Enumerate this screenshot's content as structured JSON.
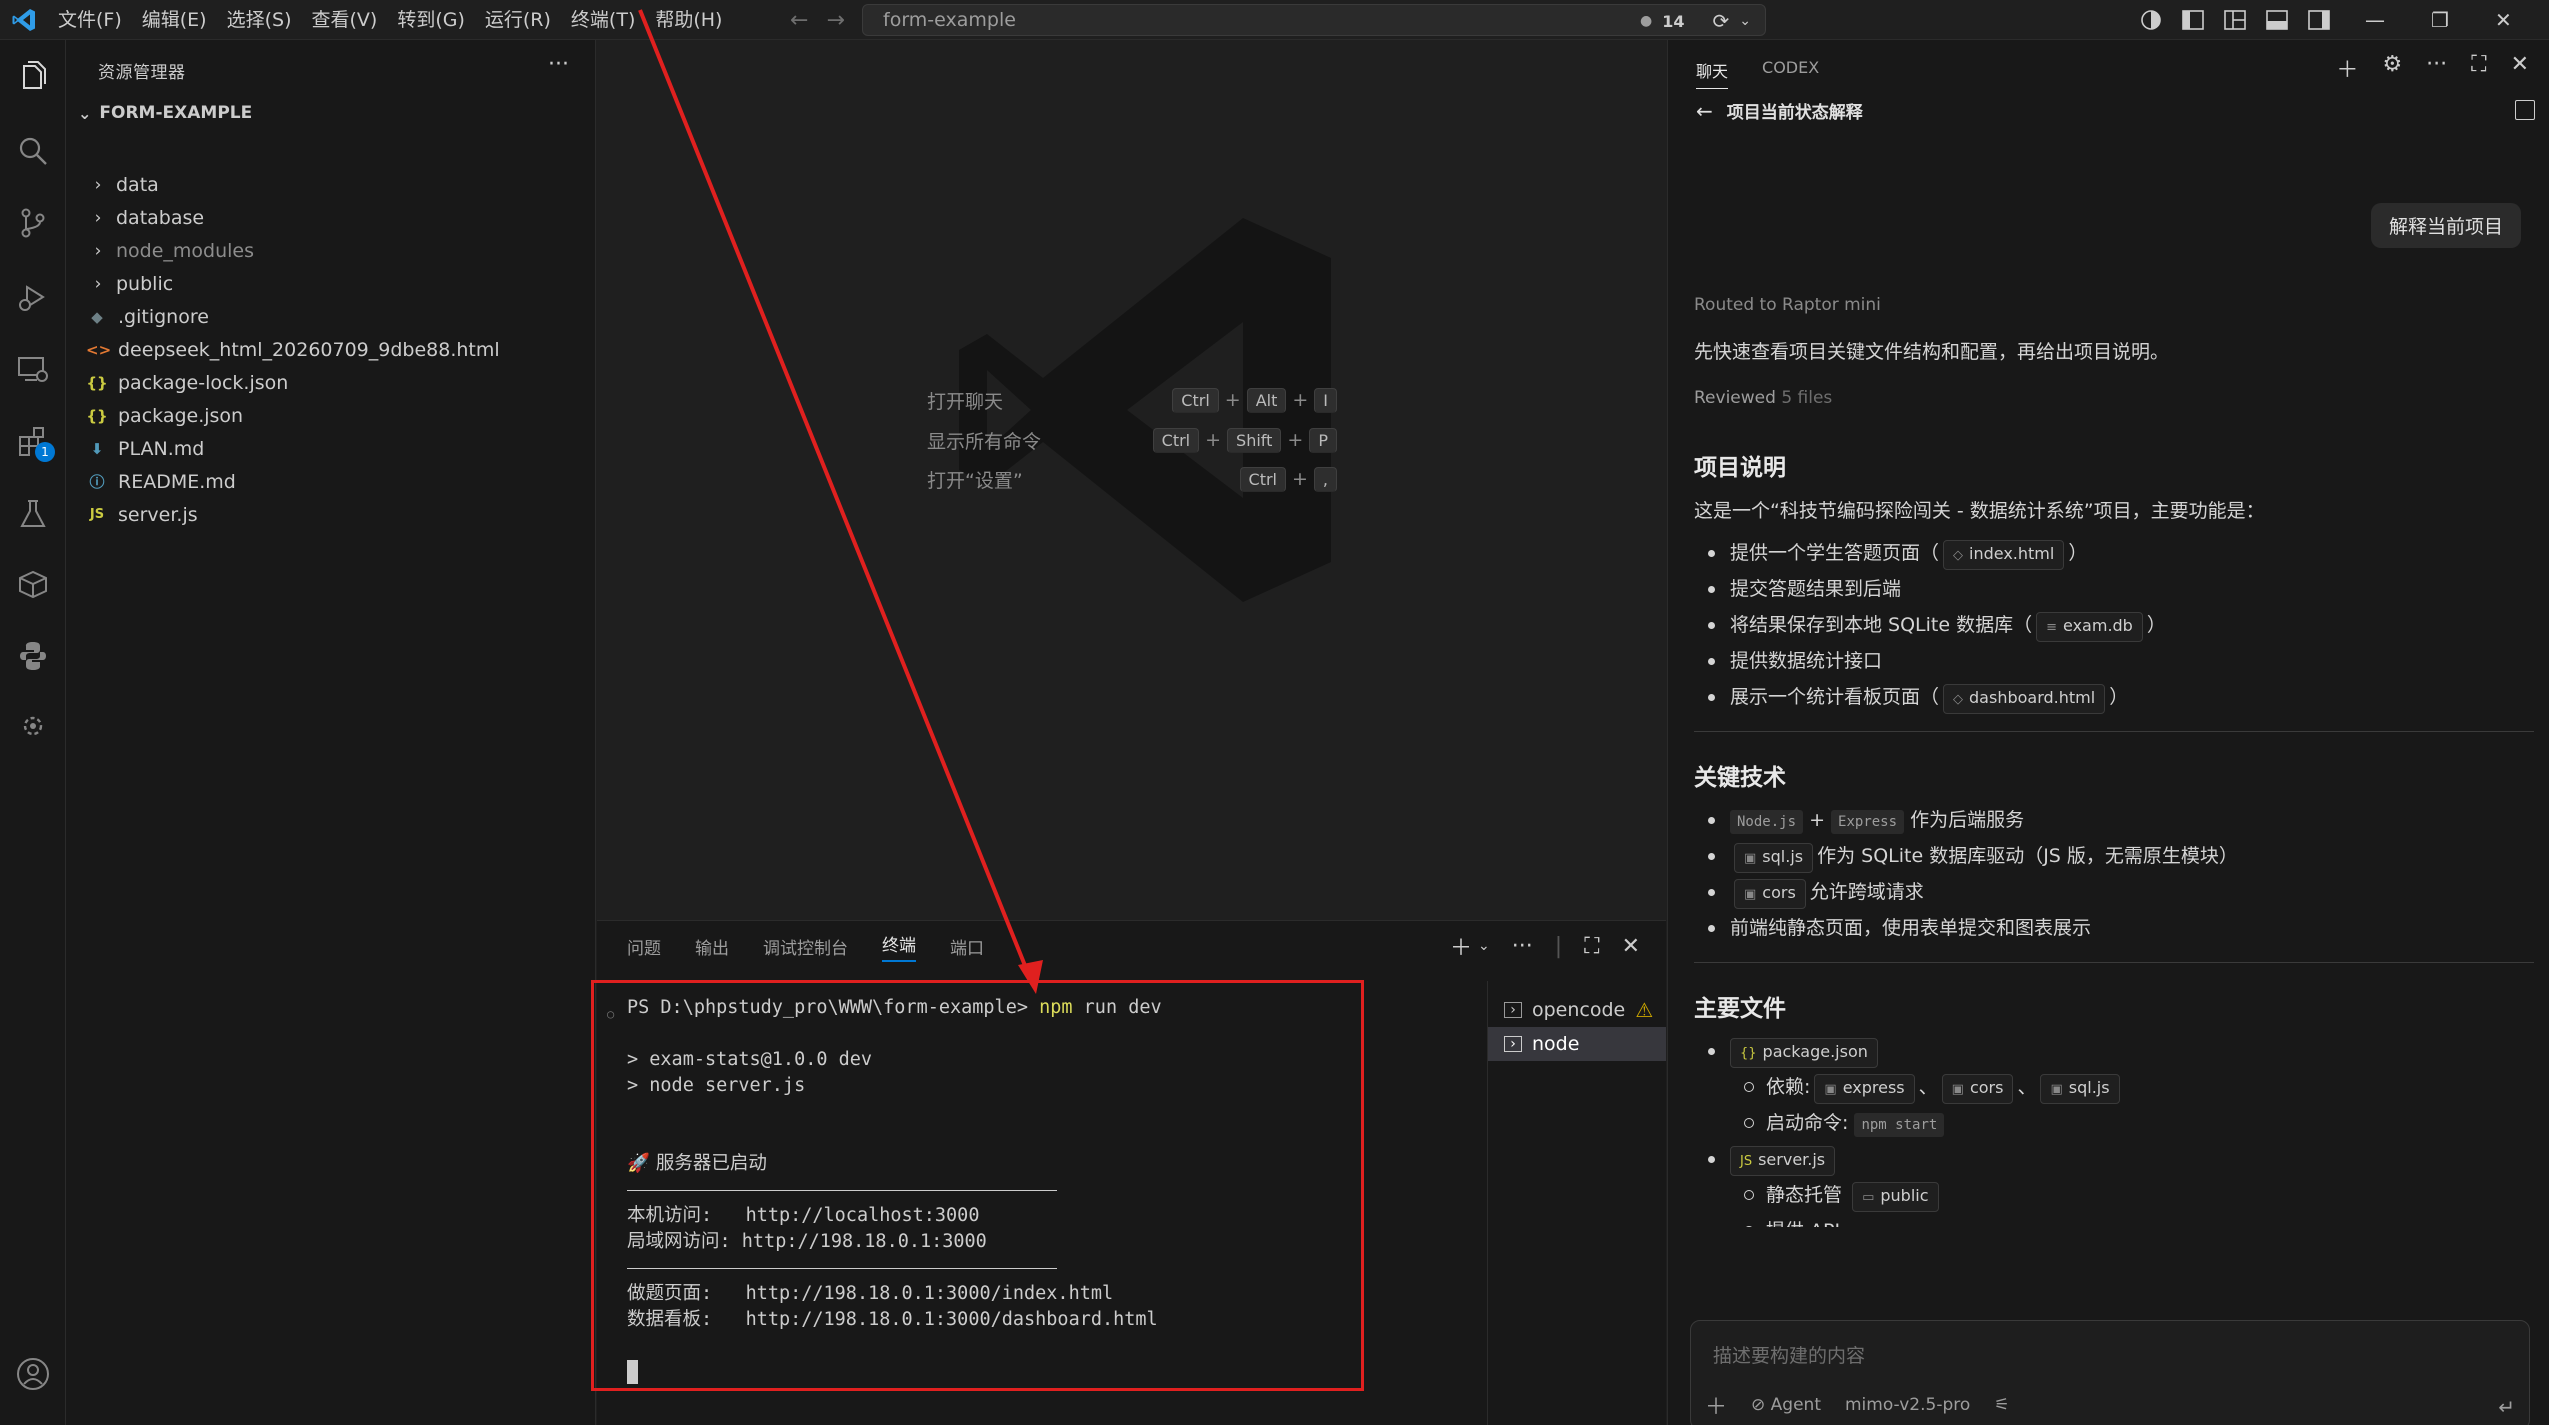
{
  "titlebar": {
    "menus": [
      "文件(F)",
      "编辑(E)",
      "选择(S)",
      "查看(V)",
      "转到(G)",
      "运行(R)",
      "终端(T)",
      "帮助(H)"
    ],
    "command_center": "form-example",
    "badge_count": "14"
  },
  "activitybar": {
    "extensions_badge": "1"
  },
  "sidebar": {
    "title": "资源管理器",
    "more": "···",
    "folder": "FORM-EXAMPLE",
    "items": [
      {
        "label": "data",
        "type": "folder"
      },
      {
        "label": "database",
        "type": "folder"
      },
      {
        "label": "node_modules",
        "type": "folder"
      },
      {
        "label": "public",
        "type": "folder"
      },
      {
        "label": ".gitignore",
        "icon": "◆",
        "color": "#6d8086"
      },
      {
        "label": "deepseek_html_20260709_9dbe88.html",
        "icon": "<>",
        "color": "#e37933"
      },
      {
        "label": "package-lock.json",
        "icon": "{}",
        "color": "#cbcb41"
      },
      {
        "label": "package.json",
        "icon": "{}",
        "color": "#cbcb41"
      },
      {
        "label": "PLAN.md",
        "icon": "⬇",
        "color": "#519aba"
      },
      {
        "label": "README.md",
        "icon": "ⓘ",
        "color": "#519aba"
      },
      {
        "label": "server.js",
        "icon": "JS",
        "color": "#cbcb41"
      }
    ]
  },
  "editor": {
    "shortcuts": [
      {
        "label": "打开聊天",
        "keys": [
          "Ctrl",
          "Alt",
          "I"
        ]
      },
      {
        "label": "显示所有命令",
        "keys": [
          "Ctrl",
          "Shift",
          "P"
        ]
      },
      {
        "label": "打开“设置”",
        "keys": [
          "Ctrl",
          ","
        ]
      }
    ]
  },
  "panel": {
    "tabs": [
      "问题",
      "输出",
      "调试控制台",
      "终端",
      "端口"
    ],
    "active_tab": "终端",
    "terminal_lines": {
      "prompt": "PS D:\\phpstudy_pro\\WWW\\form-example>",
      "command_npm": "npm",
      "command_rest": " run dev",
      "l1": "> exam-stats@1.0.0 dev",
      "l2": "> node server.js",
      "started": "🚀 服务器已启动",
      "local_label": "本机访问:",
      "local_url": "http://localhost:3000",
      "lan_label": "局域网访问:",
      "lan_url": "http://198.18.0.1:3000",
      "quiz_label": "做题页面:",
      "quiz_url": "http://198.18.0.1:3000/index.html",
      "dash_label": "数据看板:",
      "dash_url": "http://198.18.0.1:3000/dashboard.html"
    },
    "terminals": [
      {
        "label": "opencode",
        "warning": true
      },
      {
        "label": "node",
        "active": true
      }
    ]
  },
  "chat": {
    "tabs": [
      "聊天",
      "CODEX"
    ],
    "header": "项目当前状态解释",
    "user_message": "解释当前项目",
    "routed": "Routed to Raptor mini",
    "intro": "先快速查看项目关键文件结构和配置，再给出项目说明。",
    "reviewed_prefix": "Reviewed",
    "reviewed_count": "5 files",
    "s1_title": "项目说明",
    "s1_text": "这是一个“科技节编码探险闯关 - 数据统计系统”项目，主要功能是：",
    "s1_items": {
      "i1_pre": "提供一个学生答题页面（",
      "i1_chip": "index.html",
      "i1_post": "）",
      "i2": "提交答题结果到后端",
      "i3_pre": "将结果保存到本地 SQLite 数据库（",
      "i3_chip": "exam.db",
      "i3_post": "）",
      "i4": "提供数据统计接口",
      "i5_pre": "展示一个统计看板页面（",
      "i5_chip": "dashboard.html",
      "i5_post": "）"
    },
    "s2_title": "关键技术",
    "s2_items": {
      "node": "Node.js",
      "plus": "+",
      "express": "Express",
      "backend": "作为后端服务",
      "sqljs": "sql.js",
      "sqljs_desc": "作为 SQLite 数据库驱动（JS 版，无需原生模块）",
      "cors": "cors",
      "cors_desc": "允许跨域请求",
      "frontend": "前端纯静态页面，使用表单提交和图表展示"
    },
    "s3_title": "主要文件",
    "s3_items": {
      "pkg": "package.json",
      "deps_label": "依赖:",
      "dep1": "express",
      "dep2": "cors",
      "dep3": "sql.js",
      "start_label": "启动命令:",
      "start_cmd": "npm start",
      "server": "server.js",
      "static_label": "静态托管",
      "static_dir": "public",
      "api_label": "提供 API:"
    },
    "input_placeholder": "描述要构建的内容",
    "input_bar": {
      "agent": "Agent",
      "model": "mimo-v2.5-pro"
    }
  }
}
